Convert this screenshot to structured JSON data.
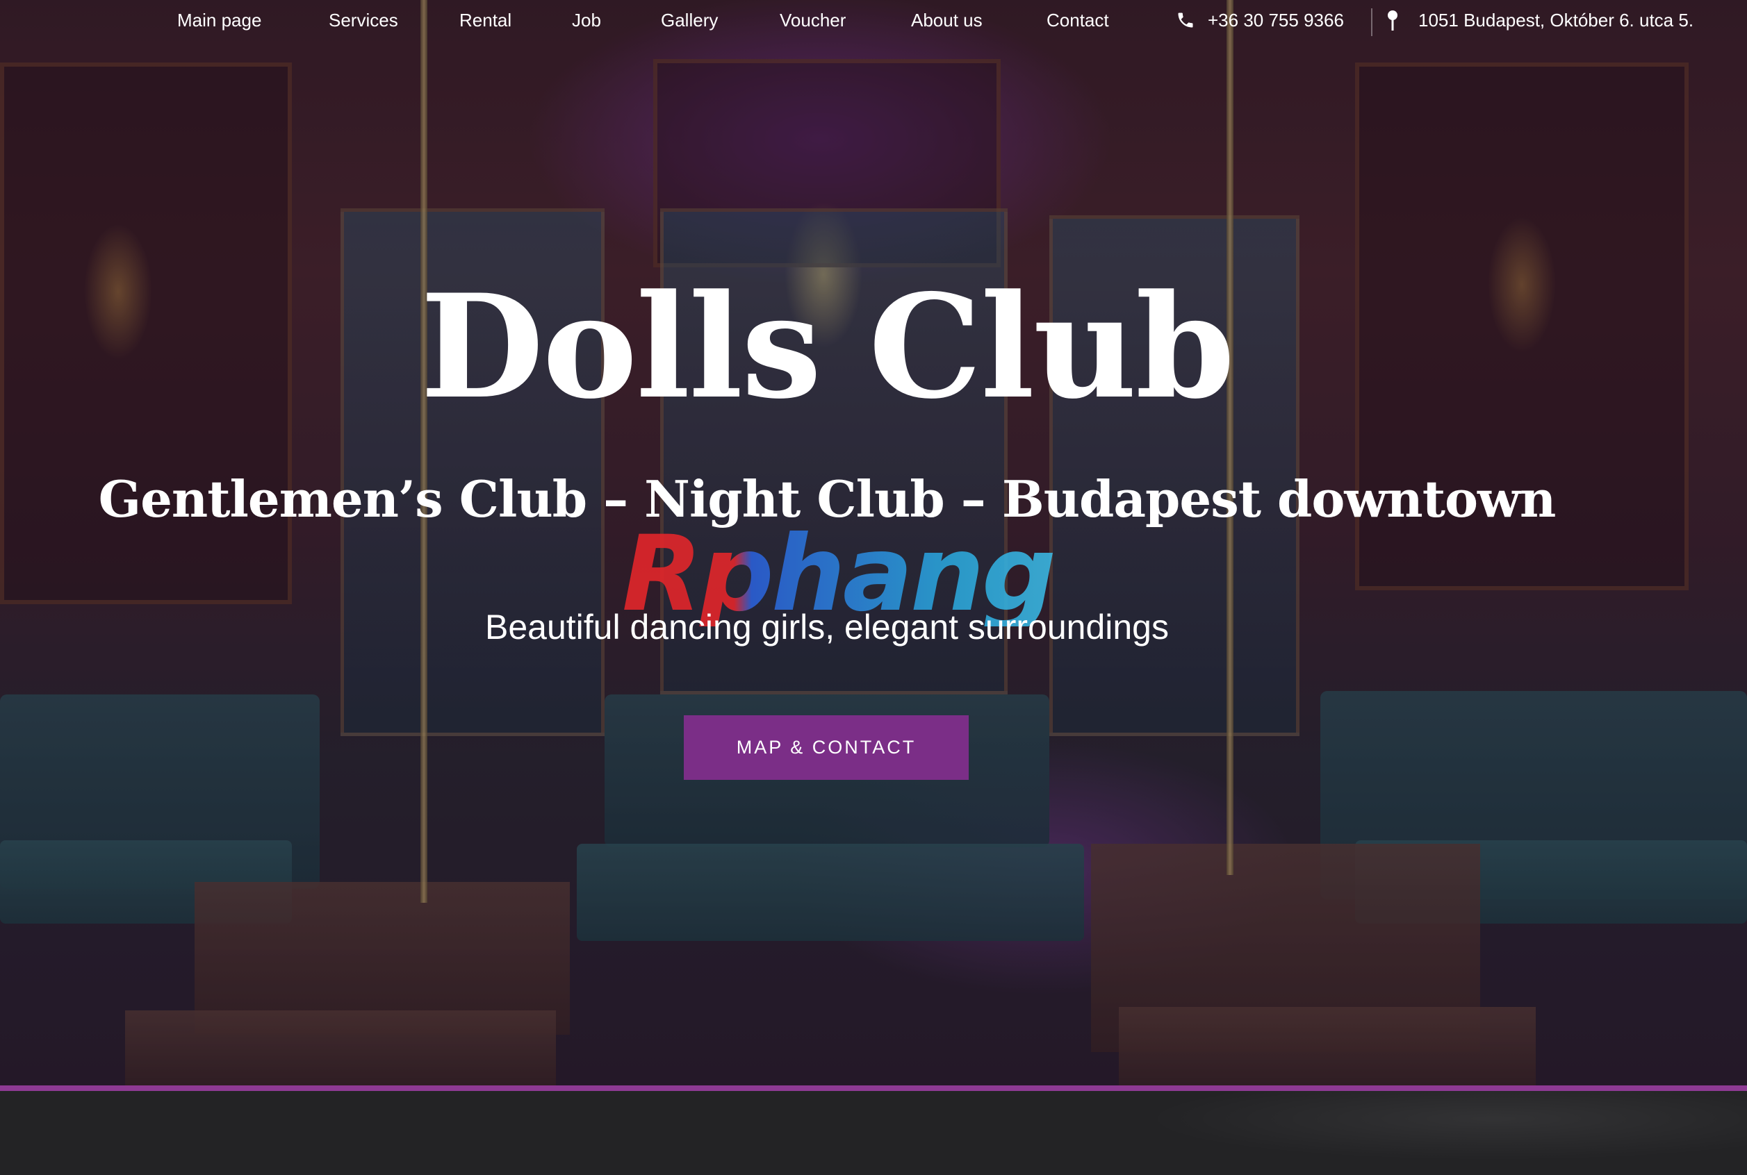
{
  "nav": {
    "items": [
      {
        "label": "Main page"
      },
      {
        "label": "Services"
      },
      {
        "label": "Rental"
      },
      {
        "label": "Job"
      },
      {
        "label": "Gallery"
      },
      {
        "label": "Voucher"
      },
      {
        "label": "About us"
      },
      {
        "label": "Contact"
      }
    ],
    "phone": "+36 30 755 9366",
    "address": "1051 Budapest, Október 6. utca 5.",
    "icons": {
      "phone": "phone-icon",
      "location": "map-pin-icon"
    }
  },
  "hero": {
    "title": "Dolls Club",
    "subtitle": "Gentlemen’s Club – Night Club – Budapest downtown",
    "tagline": "Beautiful dancing girls, elegant surroundings",
    "cta_label": "MAP & CONTACT",
    "watermark": "Rphang"
  },
  "colors": {
    "accent": "#7b2e87",
    "divider": "#8e3a94",
    "footer_bg": "#232325"
  }
}
